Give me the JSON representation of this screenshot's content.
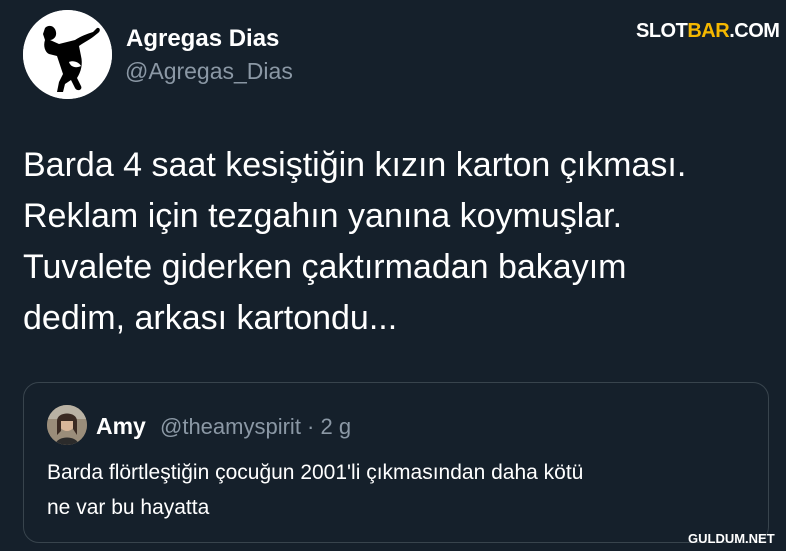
{
  "author": {
    "display_name": "Agregas Dias",
    "handle": "@Agregas_Dias",
    "avatar_icon": "dancing-silhouette-avatar"
  },
  "tweet": {
    "lines": [
      "Barda 4 saat kesiştiğin kızın karton çıkması.",
      "Reklam için tezgahın yanına koymuşlar.",
      "Tuvalete giderken çaktırmadan bakayım",
      "dedim, arkası kartondu..."
    ]
  },
  "quoted_tweet": {
    "display_name": "Amy",
    "handle_meta": "@theamyspirit · 2 g",
    "lines": [
      "Barda flörtleştiğin çocuğun 2001'li çıkmasından daha kötü",
      "ne var bu hayatta"
    ]
  },
  "watermarks": {
    "top_part1": "SLOT",
    "top_part2": "BAR",
    "top_part3": ".COM",
    "bottom": "GULDUM.NET"
  },
  "colors": {
    "background": "#15202b",
    "secondary_text": "#8b98a5",
    "border": "#38444d",
    "accent": "#f5b800"
  }
}
